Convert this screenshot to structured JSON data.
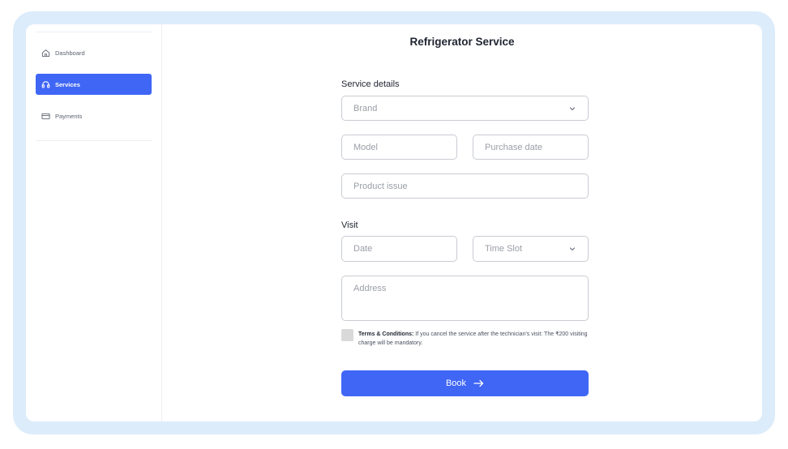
{
  "sidebar": {
    "items": [
      {
        "label": "Dashboard",
        "icon": "home-icon",
        "active": false
      },
      {
        "label": "Services",
        "icon": "headset-icon",
        "active": true
      },
      {
        "label": "Payments",
        "icon": "credit-card-icon",
        "active": false
      }
    ]
  },
  "page": {
    "title": "Refrigerator Service"
  },
  "service_details": {
    "label": "Service details",
    "brand_placeholder": "Brand",
    "model_placeholder": "Model",
    "purchase_date_placeholder": "Purchase date",
    "product_issue_placeholder": "Product issue"
  },
  "visit": {
    "label": "Visit",
    "date_placeholder": "Date",
    "time_slot_placeholder": "Time Slot",
    "address_placeholder": "Address"
  },
  "terms": {
    "title": "Terms & Conditions:",
    "text": " If you cancel the service after the technician's visit: The ₹200 visiting charge will be mandatory."
  },
  "book_button": {
    "label": "Book"
  },
  "colors": {
    "accent": "#3f66f5",
    "frame": "#dcecfb",
    "border": "#c9ccd2",
    "placeholder": "#9a9ea6"
  }
}
